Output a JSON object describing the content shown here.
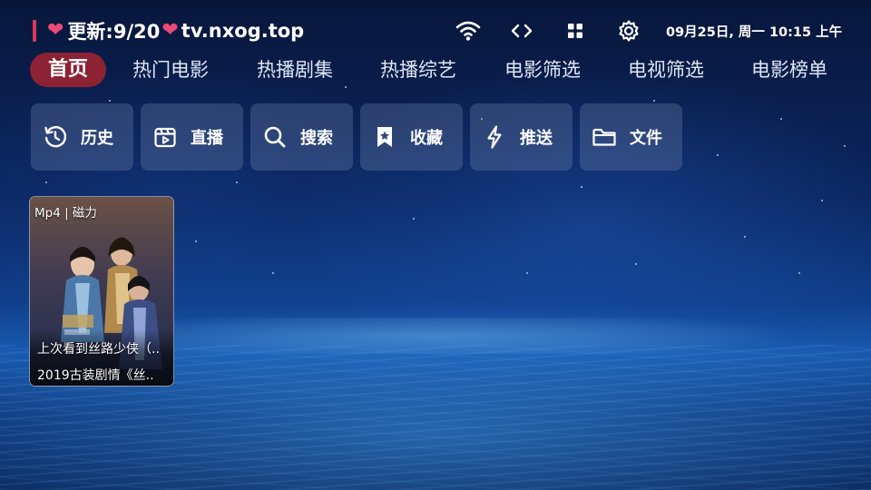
{
  "status_bar": {
    "site_prefix": "更新:9/20",
    "site_domain": "tv.nxog.top",
    "datetime": "09月25日, 周一 10:15 上午",
    "icons": [
      "wifi-icon",
      "code-arrows-icon",
      "grid-apps-icon",
      "settings-gear-icon"
    ]
  },
  "tabs": [
    {
      "label": "首页",
      "active": true
    },
    {
      "label": "热门电影",
      "active": false
    },
    {
      "label": "热播剧集",
      "active": false
    },
    {
      "label": "热播综艺",
      "active": false
    },
    {
      "label": "电影筛选",
      "active": false
    },
    {
      "label": "电视筛选",
      "active": false
    },
    {
      "label": "电影榜单",
      "active": false
    }
  ],
  "quick_actions": [
    {
      "label": "历史",
      "icon": "history-icon"
    },
    {
      "label": "直播",
      "icon": "live-tv-icon"
    },
    {
      "label": "搜索",
      "icon": "search-icon"
    },
    {
      "label": "收藏",
      "icon": "bookmark-star-icon"
    },
    {
      "label": "推送",
      "icon": "lightning-icon"
    },
    {
      "label": "文件",
      "icon": "folder-icon"
    }
  ],
  "history": [
    {
      "tag": "Mp4 | 磁力",
      "progress_text": "上次看到丝路少侠（..",
      "title": "2019古装剧情《丝.."
    }
  ],
  "colors": {
    "accent_heart": "#ec4a76",
    "active_tab_bg": "#8c2233",
    "marker_bar": "#d83a55"
  }
}
